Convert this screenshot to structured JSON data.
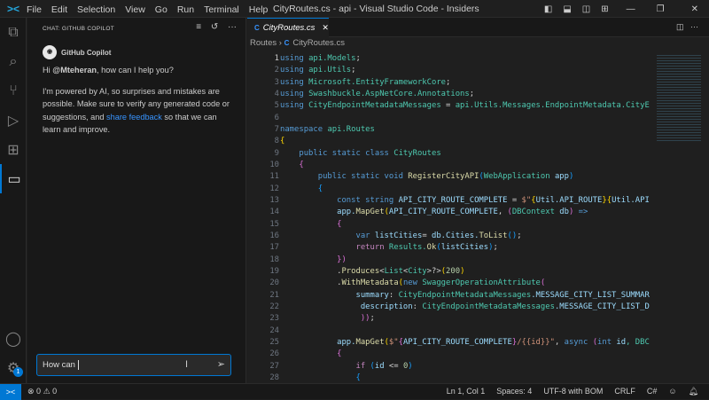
{
  "titlebar": {
    "menu": [
      "File",
      "Edit",
      "Selection",
      "View",
      "Go",
      "Run",
      "Terminal",
      "Help"
    ],
    "title": "CityRoutes.cs - api - Visual Studio Code - Insiders"
  },
  "chat": {
    "header": "CHAT: GITHUB COPILOT",
    "author": "GitHub Copilot",
    "greeting_pre": "Hi ",
    "greeting_user": "@Mteheran",
    "greeting_post": ", how can I help you?",
    "disclaimer_pre": "I'm powered by AI, so surprises and mistakes are possible. Make sure to verify any generated code or suggestions, and ",
    "feedback_link": "share feedback",
    "disclaimer_post": " so that we can learn and improve.",
    "input_value": "How can ",
    "settings_badge": "1"
  },
  "editor": {
    "tab_label": "CityRoutes.cs",
    "breadcrumb": [
      "Routes",
      "CityRoutes.cs"
    ],
    "current_line": 1,
    "lines": [
      [
        [
          "using ",
          "k"
        ],
        [
          "api.Models",
          "t"
        ],
        [
          ";",
          "p"
        ]
      ],
      [
        [
          "using ",
          "k"
        ],
        [
          "api.Utils",
          "t"
        ],
        [
          ";",
          "p"
        ]
      ],
      [
        [
          "using ",
          "k"
        ],
        [
          "Microsoft.EntityFrameworkCore",
          "t"
        ],
        [
          ";",
          "p"
        ]
      ],
      [
        [
          "using ",
          "k"
        ],
        [
          "Swashbuckle.AspNetCore.Annotations",
          "t"
        ],
        [
          ";",
          "p"
        ]
      ],
      [
        [
          "using ",
          "k"
        ],
        [
          "CityEndpointMetadataMessages",
          "t"
        ],
        [
          " = ",
          "p"
        ],
        [
          "api.Utils.Messages.EndpointMetadata.CityE",
          "t"
        ]
      ],
      [],
      [
        [
          "namespace ",
          "k"
        ],
        [
          "api.Routes",
          "t"
        ]
      ],
      [
        [
          "{",
          "b1"
        ]
      ],
      [
        [
          "    public static class ",
          "k"
        ],
        [
          "CityRoutes",
          "t"
        ]
      ],
      [
        [
          "    {",
          "b2"
        ]
      ],
      [
        [
          "        public static void ",
          "k"
        ],
        [
          "RegisterCityAPI",
          "f"
        ],
        [
          "(",
          "b3"
        ],
        [
          "WebApplication ",
          "t"
        ],
        [
          "app",
          "v"
        ],
        [
          ")",
          "b3"
        ]
      ],
      [
        [
          "        {",
          "b3"
        ]
      ],
      [
        [
          "            const string ",
          "k"
        ],
        [
          "API_CITY_ROUTE_COMPLETE",
          "v"
        ],
        [
          " = ",
          "p"
        ],
        [
          "$\"",
          "s"
        ],
        [
          "{",
          "b1"
        ],
        [
          "Util.API_ROUTE",
          "v"
        ],
        [
          "}",
          "b1"
        ],
        [
          "{",
          "b1"
        ],
        [
          "Util.API",
          "v"
        ]
      ],
      [
        [
          "            app.",
          "v"
        ],
        [
          "MapGet",
          "f"
        ],
        [
          "(",
          "b1"
        ],
        [
          "API_CITY_ROUTE_COMPLETE",
          "v"
        ],
        [
          ", ",
          "p"
        ],
        [
          "(",
          "b2"
        ],
        [
          "DBContext ",
          "t"
        ],
        [
          "db",
          "v"
        ],
        [
          ")",
          "b2"
        ],
        [
          " =>",
          "k"
        ]
      ],
      [
        [
          "            {",
          "b2"
        ]
      ],
      [
        [
          "                var ",
          "k"
        ],
        [
          "listCities",
          "v"
        ],
        [
          "= ",
          "p"
        ],
        [
          "db.Cities.",
          "v"
        ],
        [
          "ToList",
          "f"
        ],
        [
          "()",
          "b3"
        ],
        [
          ";",
          "p"
        ]
      ],
      [
        [
          "                return ",
          "c"
        ],
        [
          "Results.",
          "t"
        ],
        [
          "Ok",
          "f"
        ],
        [
          "(",
          "b3"
        ],
        [
          "listCities",
          "v"
        ],
        [
          ")",
          "b3"
        ],
        [
          ";",
          "p"
        ]
      ],
      [
        [
          "            })",
          "b2"
        ]
      ],
      [
        [
          "            .",
          "p"
        ],
        [
          "Produces",
          "f"
        ],
        [
          "<",
          "p"
        ],
        [
          "List",
          "t"
        ],
        [
          "<",
          "p"
        ],
        [
          "City",
          "t"
        ],
        [
          ">?>",
          "p"
        ],
        [
          "(",
          "b1"
        ],
        [
          "200",
          "n"
        ],
        [
          ")",
          "b1"
        ]
      ],
      [
        [
          "            .",
          "p"
        ],
        [
          "WithMetadata",
          "f"
        ],
        [
          "(",
          "b1"
        ],
        [
          "new ",
          "k"
        ],
        [
          "SwaggerOperationAttribute",
          "t"
        ],
        [
          "(",
          "b2"
        ]
      ],
      [
        [
          "                summary",
          "v"
        ],
        [
          ": ",
          "p"
        ],
        [
          "CityEndpointMetadataMessages",
          "t"
        ],
        [
          ".MESSAGE_CITY_LIST_SUMMAR",
          "v"
        ]
      ],
      [
        [
          "                 description",
          "v"
        ],
        [
          ": ",
          "p"
        ],
        [
          "CityEndpointMetadataMessages",
          "t"
        ],
        [
          ".MESSAGE_CITY_LIST_D",
          "v"
        ]
      ],
      [
        [
          "                 ",
          "p"
        ],
        [
          "))",
          "b2"
        ],
        [
          ";",
          "p"
        ]
      ],
      [],
      [
        [
          "            app.",
          "v"
        ],
        [
          "MapGet",
          "f"
        ],
        [
          "(",
          "b1"
        ],
        [
          "$\"",
          "s"
        ],
        [
          "{",
          "b2"
        ],
        [
          "API_CITY_ROUTE_COMPLETE",
          "v"
        ],
        [
          "}",
          "b2"
        ],
        [
          "/{{id}}\"",
          "s"
        ],
        [
          ", ",
          "p"
        ],
        [
          "async ",
          "k"
        ],
        [
          "(",
          "b2"
        ],
        [
          "int ",
          "k"
        ],
        [
          "id",
          "v"
        ],
        [
          ", DBC",
          "t"
        ]
      ],
      [
        [
          "            {",
          "b2"
        ]
      ],
      [
        [
          "                if ",
          "c"
        ],
        [
          "(",
          "b3"
        ],
        [
          "id ",
          "v"
        ],
        [
          "<= ",
          "p"
        ],
        [
          "0",
          "n"
        ],
        [
          ")",
          "b3"
        ]
      ],
      [
        [
          "                {",
          "b3"
        ]
      ]
    ]
  },
  "statusbar": {
    "errors": "0",
    "warnings": "0",
    "position": "Ln 1, Col 1",
    "spaces": "Spaces: 4",
    "encoding": "UTF-8 with BOM",
    "eol": "CRLF",
    "language": "C#"
  }
}
